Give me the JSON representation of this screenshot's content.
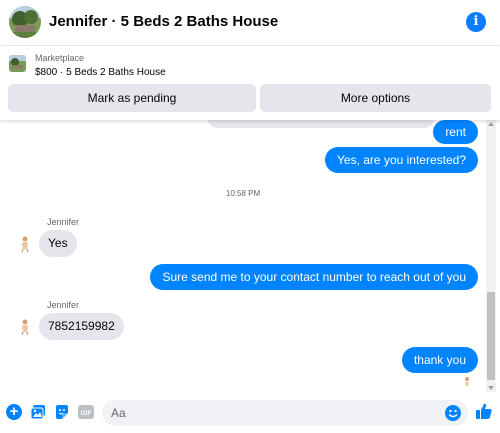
{
  "header": {
    "title": "Jennifer · 5 Beds 2 Baths House",
    "info_icon": "info-icon"
  },
  "marketplace": {
    "label": "Marketplace",
    "listing": "$800 · 5 Beds 2 Baths House",
    "buttons": {
      "mark_pending": "Mark as pending",
      "more_options": "More options"
    }
  },
  "messages": [
    {
      "from": "me",
      "text": "rent"
    },
    {
      "from": "me",
      "text": "Yes, are you interested?"
    },
    {
      "type": "timestamp",
      "text": "10:58 PM"
    },
    {
      "from": "them",
      "sender": "Jennifer",
      "text": "Yes"
    },
    {
      "from": "me",
      "text": "Sure send me to your contact number to reach out of you"
    },
    {
      "from": "them",
      "sender": "Jennifer",
      "text": "7852159982"
    },
    {
      "from": "me",
      "text": "thank  you"
    }
  ],
  "composer": {
    "placeholder": "Aa",
    "icons": [
      "plus-icon",
      "photo-icon",
      "sticker-icon",
      "gif-icon",
      "emoji-icon",
      "thumbs-up-icon"
    ],
    "gif_label": "GIF"
  },
  "colors": {
    "accent": "#0084ff",
    "bubble_gray": "#e4e6eb",
    "muted_text": "#65676b"
  }
}
